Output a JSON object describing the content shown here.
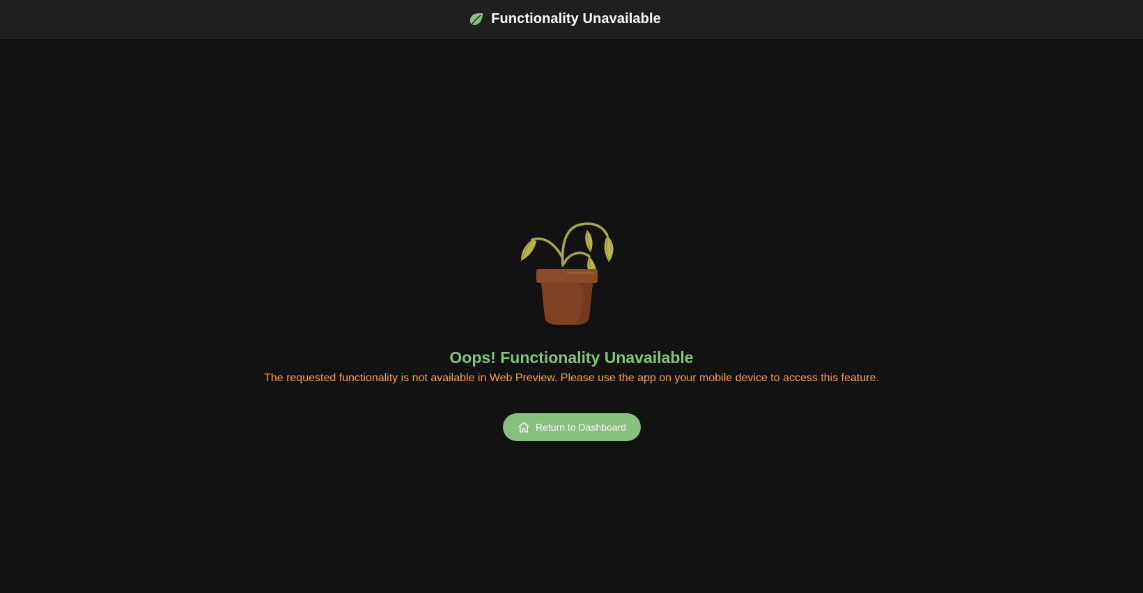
{
  "header": {
    "icon": "leaf-icon",
    "title": "Functionality Unavailable"
  },
  "main": {
    "illustration": "wilting-plant-illustration",
    "title": "Oops! Functionality Unavailable",
    "message": "The requested functionality is not available in Web Preview. Please use the app on your mobile device to access this feature.",
    "button": {
      "icon": "home-icon",
      "label": "Return to Dashboard"
    }
  },
  "colors": {
    "background": "#121212",
    "header_background": "#1f1f1f",
    "accent_green": "#86c17e",
    "message_orange": "#f3a14a",
    "pot_brown": "#8a4a26",
    "leaf_olive": "#b5b24f"
  }
}
